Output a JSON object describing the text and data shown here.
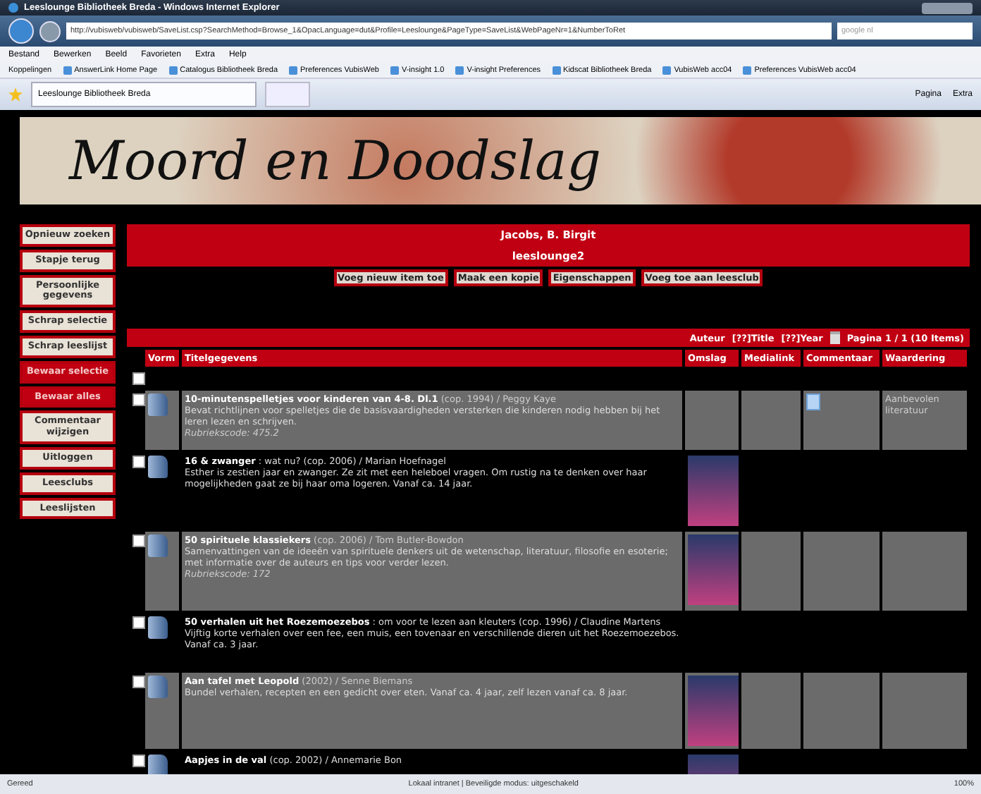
{
  "window": {
    "title": "Leeslounge Bibliotheek Breda - Windows Internet Explorer"
  },
  "address_bar": {
    "url": "http://vubisweb/vubisweb/SaveList.csp?SearchMethod=Browse_1&OpacLanguage=dut&Profile=Leeslounge&PageType=SaveList&WebPageNr=1&NumberToRet",
    "search": "google nl"
  },
  "menu": [
    "Bestand",
    "Bewerken",
    "Beeld",
    "Favorieten",
    "Extra",
    "Help"
  ],
  "links_bar": {
    "label": "Koppelingen",
    "items": [
      "AnswerLink Home Page",
      "Catalogus Bibliotheek Breda",
      "Preferences VubisWeb",
      "V-insight 1.0",
      "V-insight Preferences",
      "Kidscat Bibliotheek Breda",
      "VubisWeb acc04",
      "Preferences VubisWeb acc04"
    ]
  },
  "tab": {
    "title": "Leeslounge Bibliotheek Breda"
  },
  "tools": [
    "Pagina",
    "Extra"
  ],
  "banner": {
    "title": "Moord en Doodslag"
  },
  "sidebar": [
    {
      "label": "Opnieuw zoeken",
      "kind": "plain"
    },
    {
      "label": "Stapje terug",
      "kind": "plain"
    },
    {
      "label": "Persoonlijke gegevens",
      "kind": "plain"
    },
    {
      "label": "Schrap selectie",
      "kind": "plain"
    },
    {
      "label": "Schrap leeslijst",
      "kind": "plain"
    },
    {
      "label": "Bewaar selectie",
      "kind": "red"
    },
    {
      "label": "Bewaar alles",
      "kind": "red"
    },
    {
      "label": "Commentaar wijzigen",
      "kind": "plain"
    },
    {
      "label": "Uitloggen",
      "kind": "plain"
    },
    {
      "label": "Leesclubs",
      "kind": "plain"
    },
    {
      "label": "Leeslijsten",
      "kind": "plain"
    }
  ],
  "user": "Jacobs, B. Birgit",
  "list_name": "leeslounge2",
  "actions": [
    "Voeg nieuw item toe",
    "Maak een kopie",
    "Eigenschappen",
    "Voeg toe aan leesclub"
  ],
  "sort": {
    "links": [
      "Auteur",
      "[??]Title",
      "[??]Year"
    ],
    "pages": "Pagina 1 / 1 (10 Items)"
  },
  "select_all": {
    "checked": false
  },
  "columns": [
    "Vorm",
    "Titelgegevens",
    "Omslag",
    "Medialink",
    "Commentaar",
    "Waardering"
  ],
  "rows": [
    {
      "title": "10-minutenspelletjes voor kinderen van 4-8. Dl.1",
      "rest": " (cop. 1994) / Peggy Kaye",
      "description": "Bevat richtlijnen voor spelletjes die de basisvaardigheden versterken die kinderen nodig hebben bij het leren lezen en schrijven.",
      "code": "Rubriekscode: 475.2",
      "shaded": true,
      "cover": false,
      "comment": true,
      "rating": "Aanbevolen literatuur",
      "checked": false
    },
    {
      "title": "16 & zwanger",
      "rest": " : wat nu? (cop. 2006) / Marian Hoefnagel",
      "description": "Esther is zestien jaar en zwanger. Ze zit met een heleboel vragen. Om rustig na te denken over haar mogelijkheden gaat ze bij haar oma logeren. Vanaf ca. 14 jaar.",
      "shaded": false,
      "cover": true,
      "comment": false,
      "checked": false
    },
    {
      "title": "50 spirituele klassiekers",
      "rest": " (cop. 2006) / Tom Butler-Bowdon",
      "description": "Samenvattingen van de ideeën van spirituele denkers uit de wetenschap, literatuur, filosofie en esoterie; met informatie over de auteurs en tips voor verder lezen.",
      "code": "Rubriekscode: 172",
      "shaded": true,
      "cover": true,
      "comment": false,
      "checked": false
    },
    {
      "title": "50 verhalen uit het Roezemoezebos",
      "rest": " : om voor te lezen aan kleuters (cop. 1996) / Claudine Martens",
      "description": "Vijftig korte verhalen over een fee, een muis, een tovenaar en verschillende dieren uit het Roezemoezebos. Vanaf ca. 3 jaar.",
      "shaded": false,
      "cover": false,
      "comment": false,
      "checked": false
    },
    {
      "title": "Aan tafel met Leopold",
      "rest": " (2002) / Senne Biemans",
      "description": "Bundel verhalen, recepten en een gedicht over eten. Vanaf ca. 4 jaar, zelf lezen vanaf ca. 8 jaar.",
      "shaded": true,
      "cover": true,
      "comment": false,
      "checked": false
    },
    {
      "title": "Aapjes in de val",
      "rest": " (cop. 2002) / Annemarie Bon",
      "shaded": false,
      "cover": true,
      "comment": false,
      "checked": false
    }
  ],
  "status_bar": {
    "left": "Gereed",
    "zone": "Lokaal intranet | Beveiligde modus: uitgeschakeld",
    "zoom": "100%"
  }
}
